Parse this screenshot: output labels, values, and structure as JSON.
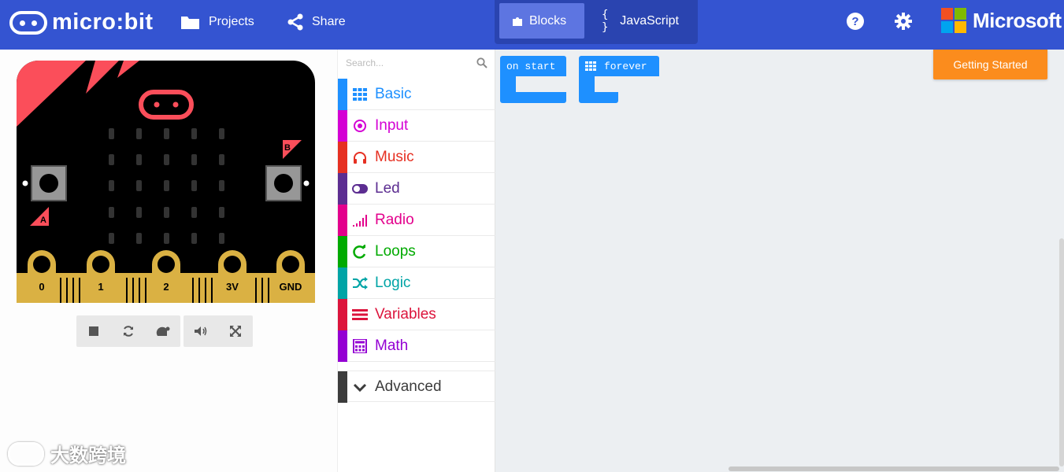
{
  "app": {
    "logo_text": "micro:bit",
    "brand_text": "Microsoft"
  },
  "nav": {
    "projects": "Projects",
    "share": "Share"
  },
  "editor_toggle": {
    "blocks": "Blocks",
    "javascript": "JavaScript",
    "active": "blocks"
  },
  "right_icons": [
    "help-icon",
    "gear-icon"
  ],
  "simulator": {
    "pins": [
      "0",
      "1",
      "2",
      "3V",
      "GND"
    ],
    "button_a": "A",
    "button_b": "B",
    "controls": [
      "stop-icon",
      "restart-icon",
      "slow-mo-icon",
      "mute-icon",
      "fullscreen-icon"
    ]
  },
  "toolbox": {
    "search_placeholder": "Search...",
    "categories": [
      {
        "label": "Basic",
        "color": "#1e90ff",
        "icon": "grid-icon"
      },
      {
        "label": "Input",
        "color": "#d400d4",
        "icon": "radio-circle-icon"
      },
      {
        "label": "Music",
        "color": "#e63022",
        "icon": "headphones-icon"
      },
      {
        "label": "Led",
        "color": "#5c2d91",
        "icon": "toggle-icon"
      },
      {
        "label": "Radio",
        "color": "#e3008c",
        "icon": "signal-bars-icon"
      },
      {
        "label": "Loops",
        "color": "#00aa00",
        "icon": "loop-arrow-icon"
      },
      {
        "label": "Logic",
        "color": "#00a4a6",
        "icon": "shuffle-icon"
      },
      {
        "label": "Variables",
        "color": "#dc143c",
        "icon": "list-icon"
      },
      {
        "label": "Math",
        "color": "#9400d3",
        "icon": "calculator-icon"
      }
    ],
    "advanced": "Advanced"
  },
  "workspace": {
    "blocks": [
      "on start",
      "forever"
    ],
    "getting_started": "Getting Started"
  },
  "watermark": "大数跨境",
  "colors": {
    "topbar": "#3454d1",
    "block_blue": "#1e90ff",
    "getting_started": "#fb8c1d",
    "board_red": "#fb4e5a",
    "board_gold": "#dab143"
  }
}
